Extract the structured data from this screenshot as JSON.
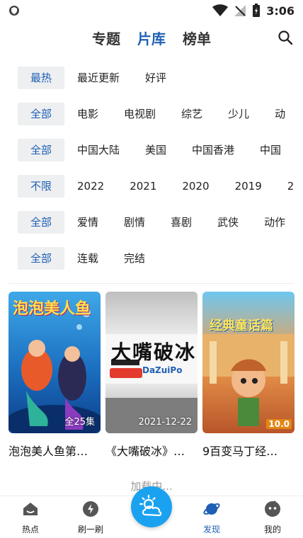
{
  "status_bar": {
    "time": "3:06"
  },
  "top_nav": {
    "tabs": [
      {
        "label": "专题",
        "active": false
      },
      {
        "label": "片库",
        "active": true
      },
      {
        "label": "榜单",
        "active": false
      }
    ]
  },
  "filters": {
    "sort": {
      "selected": "最热",
      "options": [
        "最近更新",
        "好评"
      ]
    },
    "type": {
      "selected": "全部",
      "options": [
        "电影",
        "电视剧",
        "综艺",
        "少儿",
        "动"
      ]
    },
    "region": {
      "selected": "全部",
      "options": [
        "中国大陆",
        "美国",
        "中国香港",
        "中国"
      ]
    },
    "year": {
      "selected": "不限",
      "options": [
        "2022",
        "2021",
        "2020",
        "2019",
        "2"
      ]
    },
    "genre": {
      "selected": "全部",
      "options": [
        "爱情",
        "剧情",
        "喜剧",
        "武侠",
        "动作"
      ]
    },
    "status": {
      "selected": "全部",
      "options": [
        "连载",
        "完结"
      ]
    }
  },
  "posters": [
    {
      "title": "泡泡美人鱼第…",
      "badge": "全25集",
      "art_text": "泡泡美人鱼"
    },
    {
      "title": "《大嘴破冰》…",
      "badge": "2021-12-22",
      "art_text": "大嘴破冰",
      "art_sub": "DaZuiPo"
    },
    {
      "title": "9百变马丁经…",
      "badge": "10.0",
      "art_text": "经典童话篇"
    }
  ],
  "loading_text": "加载中...",
  "bottom_nav": {
    "items": [
      {
        "label": "热点",
        "icon": "house-icon"
      },
      {
        "label": "刷一刷",
        "icon": "refresh-icon"
      },
      {
        "label": "发现",
        "icon": "planet-icon",
        "active": true
      },
      {
        "label": "我的",
        "icon": "profile-icon"
      }
    ],
    "center_icon": "weather-icon"
  },
  "colors": {
    "accent": "#1f5fb4",
    "center_button": "#1aa2f0",
    "chip_bg": "#eeeff1"
  }
}
